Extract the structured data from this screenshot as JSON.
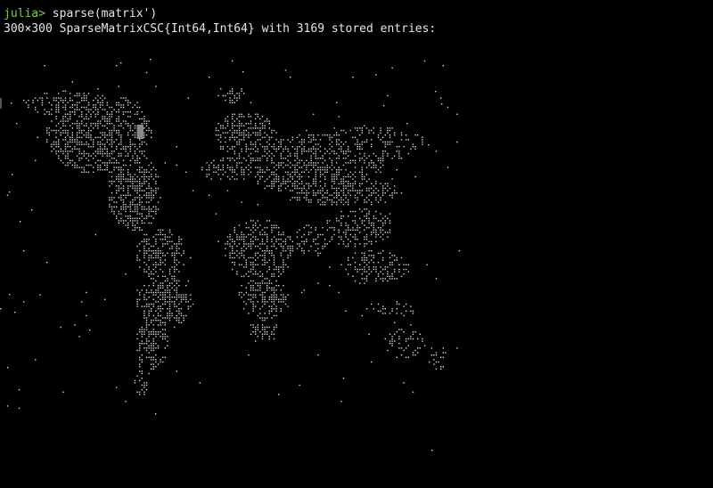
{
  "terminal": {
    "prompt": "julia>",
    "command": " sparse(matrix')",
    "output": "300×300 SparseMatrixCSC{Int64,Int64} with 3169 stored entries:"
  },
  "colors": {
    "background": "#000000",
    "prompt": "#7cd03c",
    "text": "#e6e6e6",
    "dots": "#d8d8d8",
    "cursor": "#8a8a8a"
  },
  "spy_plot": {
    "description_icon": "braille-dot-map",
    "matrix_rows": 300,
    "matrix_cols": 300,
    "stored_entries": 3169
  }
}
